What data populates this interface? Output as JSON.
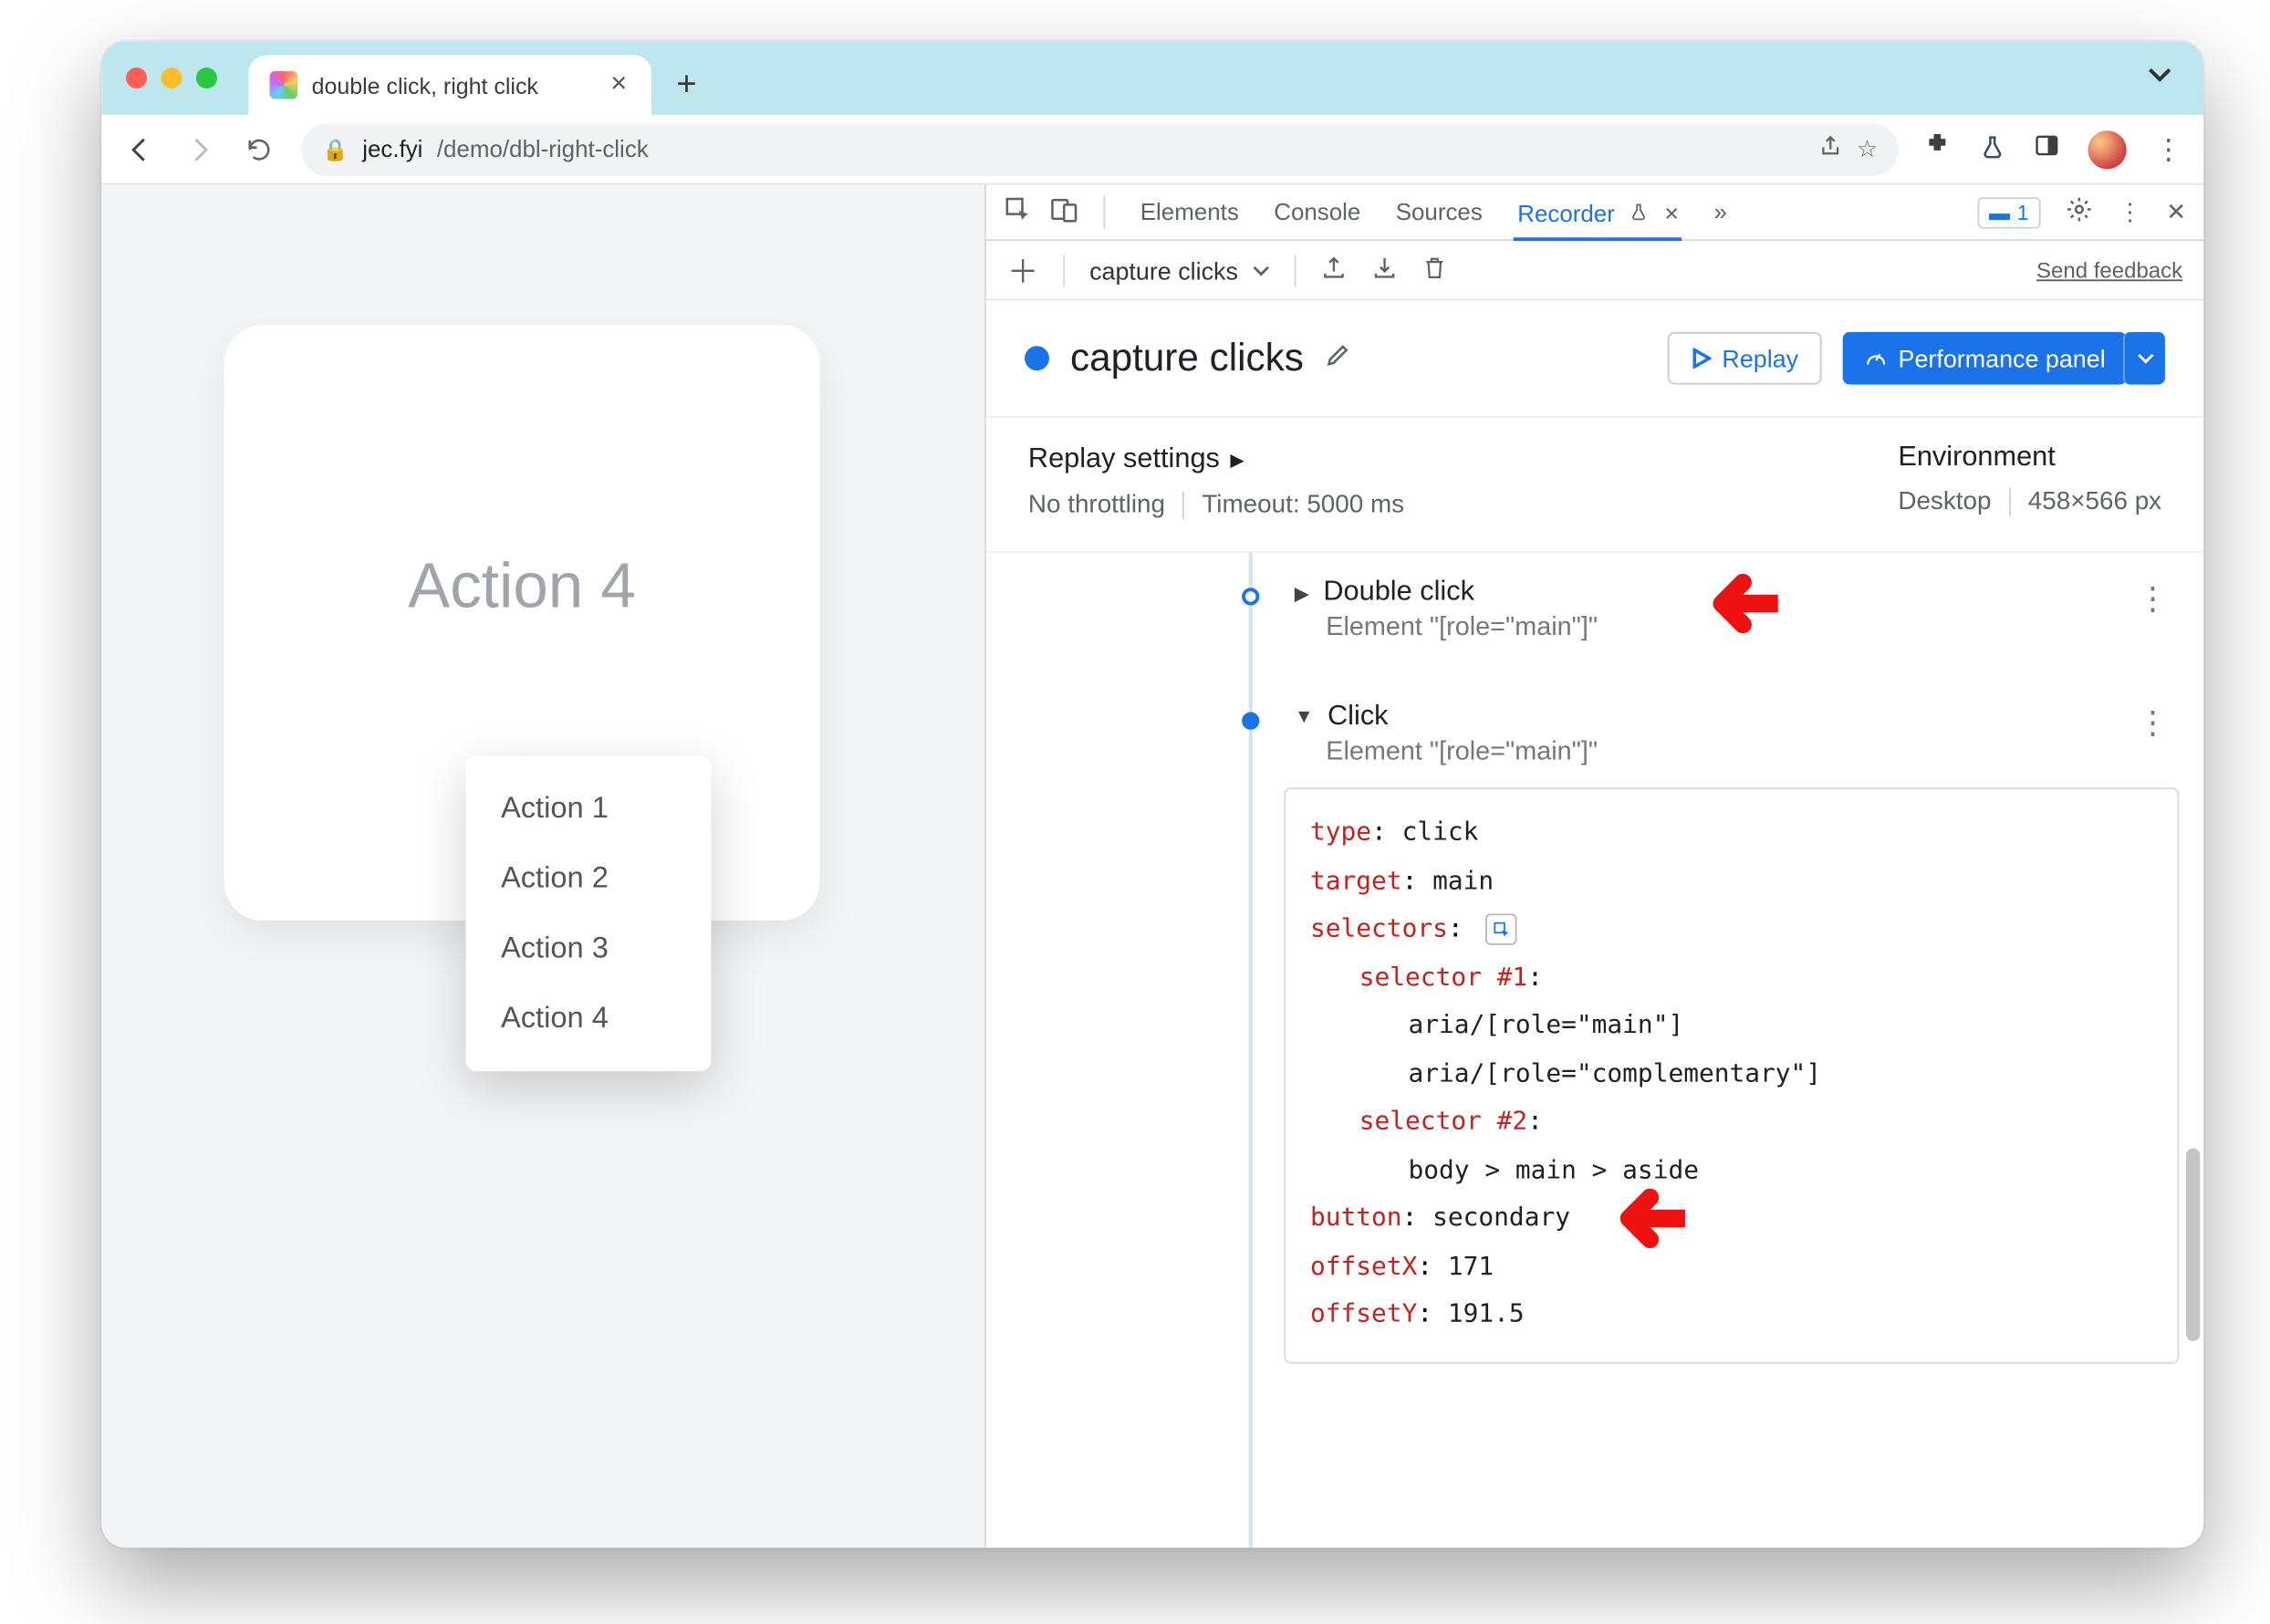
{
  "tab": {
    "title": "double click, right click"
  },
  "url": {
    "host": "jec.fyi",
    "path": "/demo/dbl-right-click"
  },
  "page": {
    "card_title": "Action 4",
    "menu": [
      "Action 1",
      "Action 2",
      "Action 3",
      "Action 4"
    ]
  },
  "devtools": {
    "tabs": [
      "Elements",
      "Console",
      "Sources",
      "Recorder"
    ],
    "active_tab": "Recorder",
    "issues_count": "1",
    "toolbar": {
      "recording_selector": "capture clicks",
      "feedback": "Send feedback"
    },
    "header": {
      "title": "capture clicks",
      "replay_btn": "Replay",
      "perf_btn": "Performance panel"
    },
    "settings": {
      "replay_heading": "Replay settings",
      "throttling": "No throttling",
      "timeout": "Timeout: 5000 ms",
      "env_heading": "Environment",
      "device": "Desktop",
      "viewport": "458×566 px"
    },
    "steps": [
      {
        "title": "Double click",
        "subtitle": "Element \"[role=\"main\"]\"",
        "expanded": false
      },
      {
        "title": "Click",
        "subtitle": "Element \"[role=\"main\"]\"",
        "expanded": true,
        "detail": {
          "type_k": "type",
          "type_v": "click",
          "target_k": "target",
          "target_v": "main",
          "selectors_k": "selectors",
          "sel1_k": "selector #1",
          "sel1_a": "aria/[role=\"main\"]",
          "sel1_b": "aria/[role=\"complementary\"]",
          "sel2_k": "selector #2",
          "sel2_a": "body > main > aside",
          "button_k": "button",
          "button_v": "secondary",
          "offx_k": "offsetX",
          "offx_v": "171",
          "offy_k": "offsetY",
          "offy_v": "191.5"
        }
      }
    ]
  }
}
